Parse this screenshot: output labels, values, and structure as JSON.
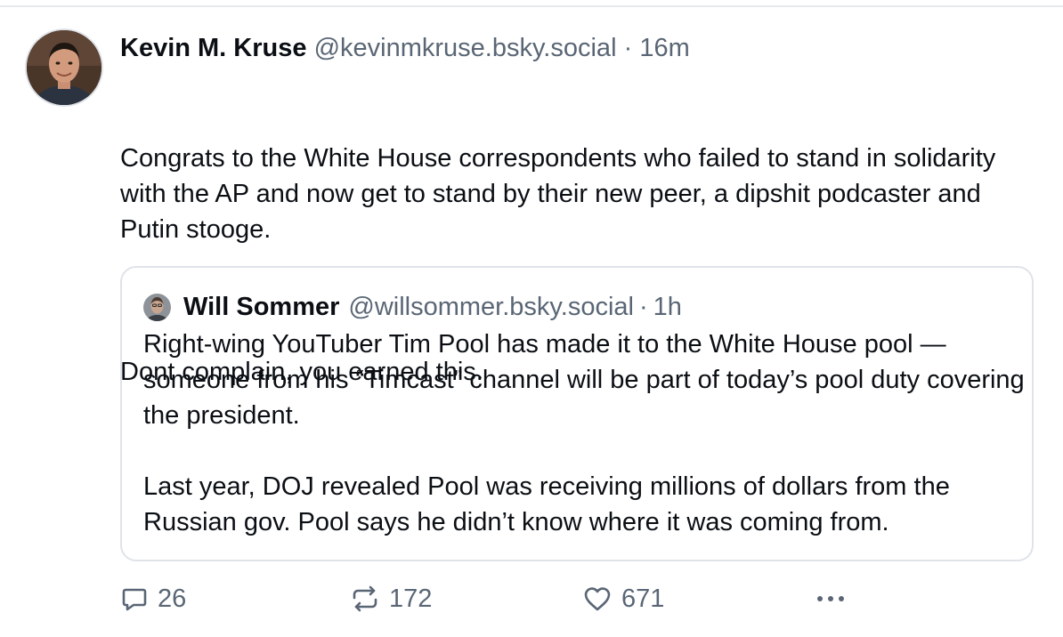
{
  "post": {
    "author_name": "Kevin M. Kruse",
    "author_handle": "@kevinmkruse.bsky.social",
    "separator": "·",
    "time": "16m",
    "text_paragraphs": [
      "Congrats to the White House correspondents who failed to stand in solidarity with the AP and now get to stand by their new peer, a dipshit podcaster and Putin stooge.",
      "Dont complain, you earned this."
    ]
  },
  "quote": {
    "author_name": "Will Sommer",
    "author_handle": "@willsommer.bsky.social",
    "separator": "·",
    "time": "1h",
    "text_paragraphs": [
      "Right-wing YouTuber Tim Pool has made it to the White House pool — someone from his “Timcast” channel will be part of today’s pool duty covering the president.",
      "Last year, DOJ revealed Pool was receiving millions of dollars from the Russian gov. Pool says he didn’t know where it was coming from."
    ]
  },
  "actions": {
    "reply_count": "26",
    "repost_count": "172",
    "like_count": "671"
  },
  "icons": {
    "reply": "reply-icon",
    "repost": "repost-icon",
    "like": "heart-icon",
    "more": "more-icon"
  },
  "colors": {
    "text": "#0b0f14",
    "muted": "#5a6675",
    "border": "#dfe3e8"
  }
}
